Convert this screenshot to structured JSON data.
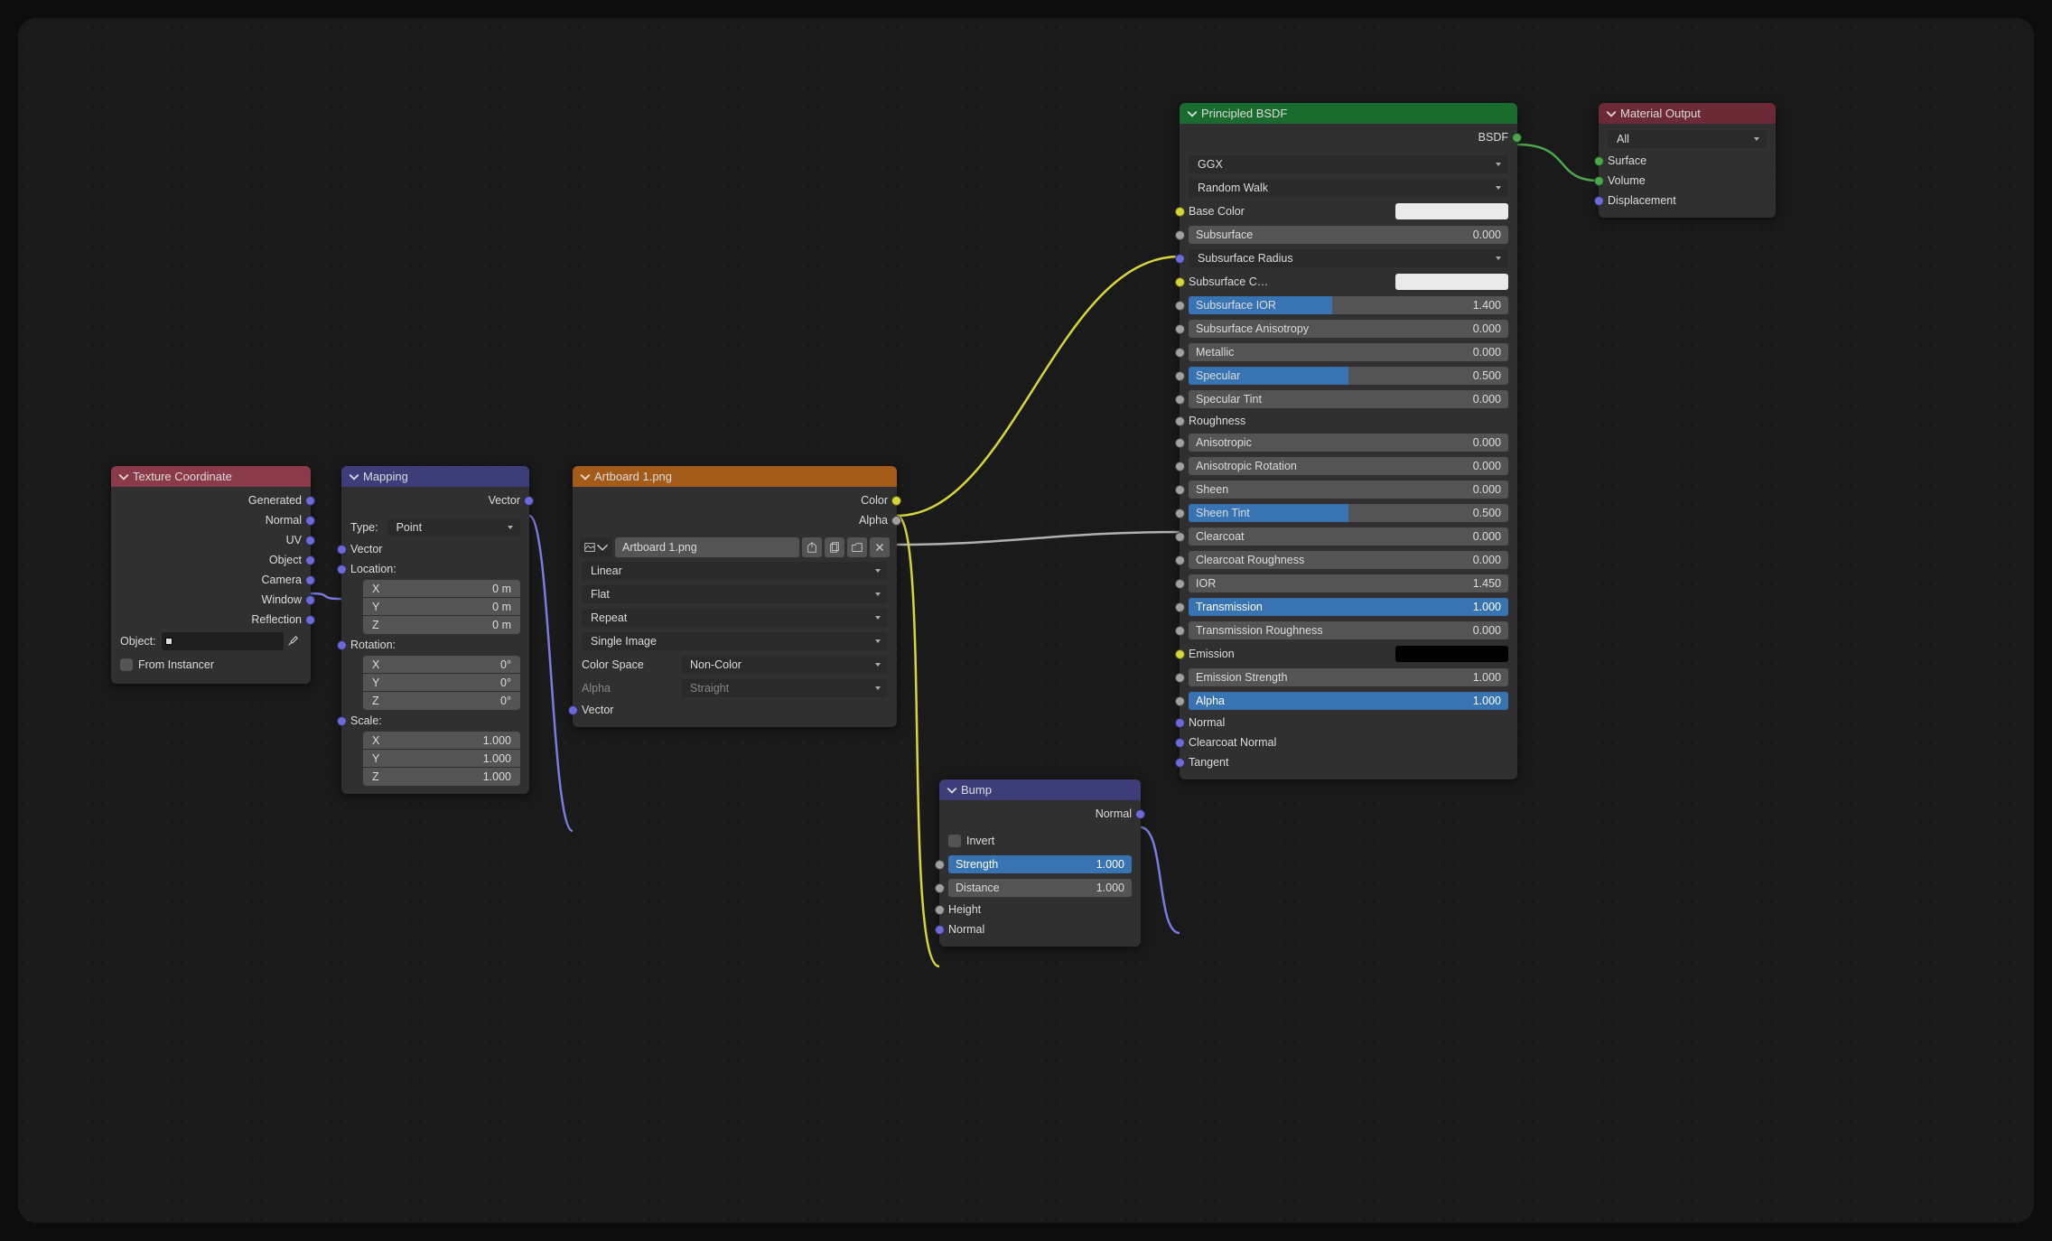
{
  "texcoord": {
    "title": "Texture Coordinate",
    "outputs": [
      "Generated",
      "Normal",
      "UV",
      "Object",
      "Camera",
      "Window",
      "Reflection"
    ],
    "object_label": "Object:",
    "from_instancer": "From Instancer"
  },
  "mapping": {
    "title": "Mapping",
    "out_vector": "Vector",
    "type_label": "Type:",
    "type_value": "Point",
    "in_vector": "Vector",
    "location_label": "Location:",
    "loc": {
      "x": "X",
      "y": "Y",
      "z": "Z",
      "xv": "0 m",
      "yv": "0 m",
      "zv": "0 m"
    },
    "rotation_label": "Rotation:",
    "rot": {
      "x": "X",
      "y": "Y",
      "z": "Z",
      "xv": "0°",
      "yv": "0°",
      "zv": "0°"
    },
    "scale_label": "Scale:",
    "scl": {
      "x": "X",
      "y": "Y",
      "z": "Z",
      "xv": "1.000",
      "yv": "1.000",
      "zv": "1.000"
    }
  },
  "image": {
    "title": "Artboard 1.png",
    "out_color": "Color",
    "out_alpha": "Alpha",
    "filename": "Artboard 1.png",
    "interp": "Linear",
    "projection": "Flat",
    "extension": "Repeat",
    "source": "Single Image",
    "colorspace_label": "Color Space",
    "colorspace": "Non-Color",
    "alpha_label": "Alpha",
    "alpha_mode": "Straight",
    "in_vector": "Vector"
  },
  "bump": {
    "title": "Bump",
    "out_normal": "Normal",
    "invert": "Invert",
    "strength_label": "Strength",
    "strength": "1.000",
    "distance_label": "Distance",
    "distance": "1.000",
    "height": "Height",
    "normal": "Normal"
  },
  "bsdf": {
    "title": "Principled BSDF",
    "out_bsdf": "BSDF",
    "ggx": "GGX",
    "random_walk": "Random Walk",
    "base_color": "Base Color",
    "subsurface": {
      "l": "Subsurface",
      "v": "0.000"
    },
    "subsurface_radius": "Subsurface Radius",
    "subsurface_color": "Subsurface C…",
    "subsurface_ior": {
      "l": "Subsurface IOR",
      "v": "1.400"
    },
    "subsurface_aniso": {
      "l": "Subsurface Anisotropy",
      "v": "0.000"
    },
    "metallic": {
      "l": "Metallic",
      "v": "0.000"
    },
    "specular": {
      "l": "Specular",
      "v": "0.500"
    },
    "specular_tint": {
      "l": "Specular Tint",
      "v": "0.000"
    },
    "roughness": "Roughness",
    "anisotropic": {
      "l": "Anisotropic",
      "v": "0.000"
    },
    "anisotropic_rot": {
      "l": "Anisotropic Rotation",
      "v": "0.000"
    },
    "sheen": {
      "l": "Sheen",
      "v": "0.000"
    },
    "sheen_tint": {
      "l": "Sheen Tint",
      "v": "0.500"
    },
    "clearcoat": {
      "l": "Clearcoat",
      "v": "0.000"
    },
    "clearcoat_rough": {
      "l": "Clearcoat Roughness",
      "v": "0.000"
    },
    "ior": {
      "l": "IOR",
      "v": "1.450"
    },
    "transmission": {
      "l": "Transmission",
      "v": "1.000"
    },
    "transmission_rough": {
      "l": "Transmission Roughness",
      "v": "0.000"
    },
    "emission": "Emission",
    "emission_strength": {
      "l": "Emission Strength",
      "v": "1.000"
    },
    "alpha": {
      "l": "Alpha",
      "v": "1.000"
    },
    "normal": "Normal",
    "clearcoat_normal": "Clearcoat Normal",
    "tangent": "Tangent"
  },
  "output": {
    "title": "Material Output",
    "target": "All",
    "surface": "Surface",
    "volume": "Volume",
    "displacement": "Displacement"
  }
}
